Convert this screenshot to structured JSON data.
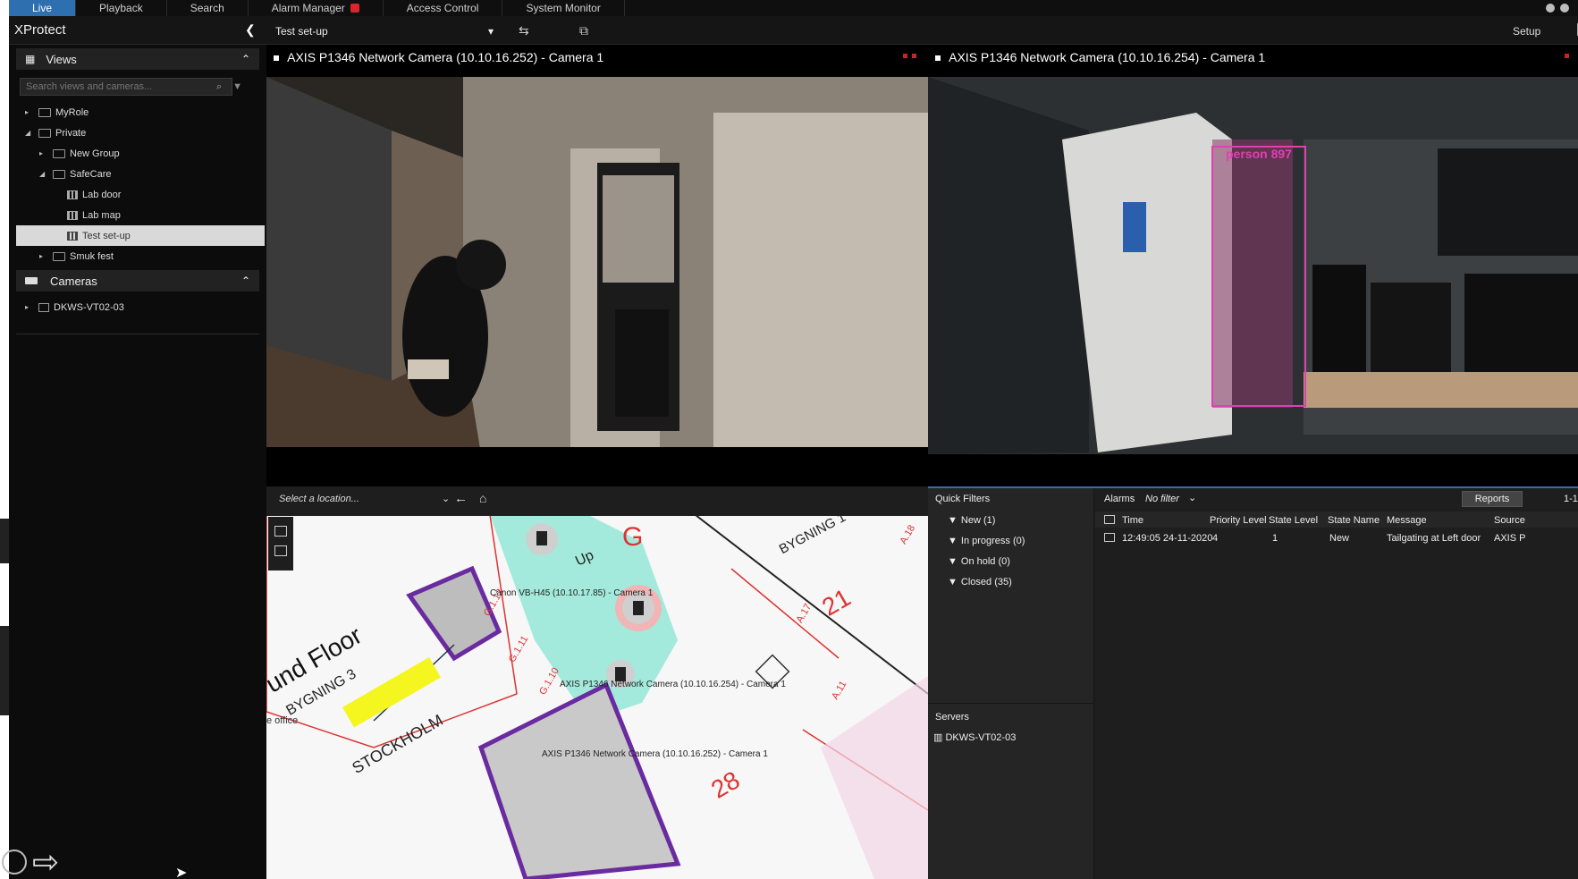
{
  "top_tabs": [
    {
      "label": "Live",
      "active": true
    },
    {
      "label": "Playback"
    },
    {
      "label": "Search"
    },
    {
      "label": "Alarm Manager",
      "badge": true
    },
    {
      "label": "Access Control"
    },
    {
      "label": "System Monitor"
    }
  ],
  "toolbar": {
    "app_title": "XProtect",
    "view_name": "Test set-up",
    "setup_label": "Setup"
  },
  "views_panel": {
    "title": "Views",
    "search_placeholder": "Search views and cameras...",
    "tree": [
      {
        "label": "MyRole",
        "level": 0,
        "arrow": "▸",
        "icon": "folder"
      },
      {
        "label": "Private",
        "level": 0,
        "arrow": "◢",
        "icon": "folder"
      },
      {
        "label": "New Group",
        "level": 1,
        "arrow": "▸",
        "icon": "folder"
      },
      {
        "label": "SafeCare",
        "level": 1,
        "arrow": "◢",
        "icon": "folder"
      },
      {
        "label": "Lab door",
        "level": 2,
        "arrow": "",
        "icon": "grid"
      },
      {
        "label": "Lab map",
        "level": 2,
        "arrow": "",
        "icon": "grid"
      },
      {
        "label": "Test set-up",
        "level": 2,
        "arrow": "",
        "icon": "grid",
        "selected": true
      },
      {
        "label": "Smuk fest",
        "level": 1,
        "arrow": "▸",
        "icon": "folder"
      }
    ]
  },
  "cameras_panel": {
    "title": "Cameras",
    "server": "DKWS-VT02-03"
  },
  "cameras": [
    {
      "title": "AXIS P1346 Network Camera (10.10.16.252) - Camera 1"
    },
    {
      "title": "AXIS P1346 Network Camera (10.10.16.254) - Camera 1",
      "detection_label": "person 897"
    }
  ],
  "map": {
    "location_placeholder": "Select a location...",
    "labels": {
      "ground_floor": "und Floor",
      "building3": "BYGNING 3",
      "building1": "BYGNING 1",
      "stockholm": "STOCKHOLM",
      "office": "e office",
      "room_g": "G",
      "room_21": "21",
      "room_28": "28",
      "up": "Up",
      "g_112": "G.1.12",
      "g_111": "G.1.11",
      "g_110": "G.1.10",
      "a17": "A.17",
      "a18": "A.18",
      "a11": "A.11"
    },
    "camera_labels": [
      "Canon VB-H45 (10.10.17.85) - Camera 1",
      "AXIS P1346 Network Camera (10.10.16.254) - Camera 1",
      "AXIS P1346 Network Camera (10.10.16.252) - Camera 1"
    ]
  },
  "alarms": {
    "quick_filters_title": "Quick Filters",
    "quick_filters": [
      "New (1)",
      "In progress (0)",
      "On hold (0)",
      "Closed (35)"
    ],
    "servers_title": "Servers",
    "server": "DKWS-VT02-03",
    "tab_label": "Alarms",
    "filter_label": "No filter",
    "reports_label": "Reports",
    "page_count": "1-1",
    "columns": [
      "Time",
      "Priority Level",
      "State Level",
      "State Name",
      "Message",
      "Source"
    ],
    "rows": [
      {
        "time": "12:49:05 24-11-2020",
        "priority": "4",
        "state_level": "1",
        "state_name": "New",
        "message": "Tailgating at Left door",
        "source": "AXIS P"
      }
    ]
  },
  "colors": {
    "accent": "#2e6fb0",
    "alarm_red": "#d8262b",
    "detection_magenta": "#e040b0",
    "map_purple": "#6a2aa0",
    "map_teal": "#5fe0c8",
    "stockholm_yellow": "#f5f520"
  }
}
